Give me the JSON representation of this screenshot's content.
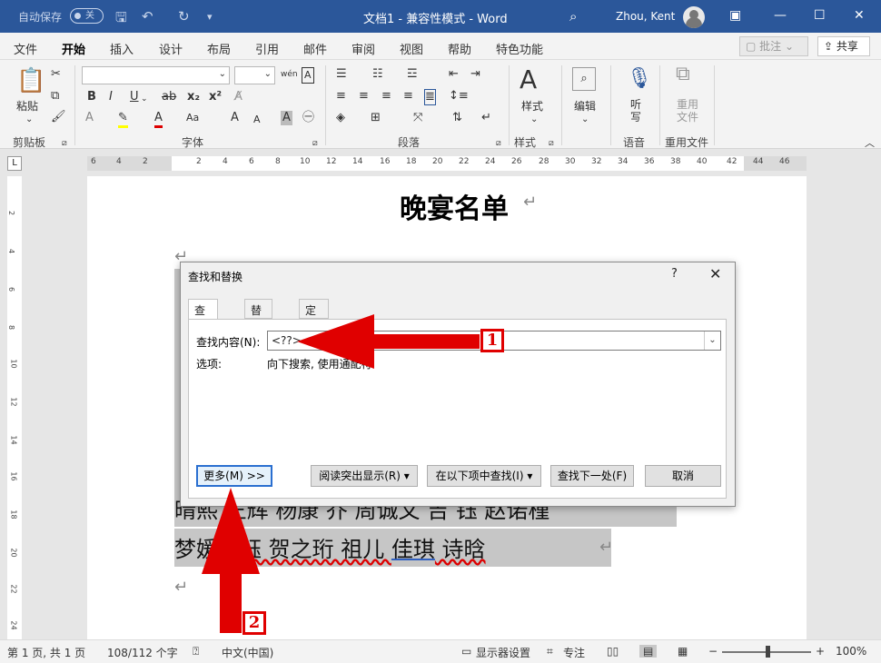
{
  "titlebar": {
    "autosave_label": "自动保存",
    "autosave_state": "关",
    "document_title": "文档1 - 兼容性模式 - Word",
    "user_name": "Zhou, Kent"
  },
  "menu": {
    "tabs": [
      "文件",
      "开始",
      "插入",
      "设计",
      "布局",
      "引用",
      "邮件",
      "审阅",
      "视图",
      "帮助",
      "特色功能"
    ],
    "comment_label": "批注",
    "share_label": "共享"
  },
  "ribbon": {
    "paste_label": "粘贴",
    "groups": [
      "剪贴板",
      "字体",
      "段落",
      "样式",
      "语音",
      "重用文件"
    ],
    "styles_label": "样式",
    "edit_label": "编辑",
    "dictate_label": "听写",
    "reuse_label": "重用文件",
    "font_buttons": [
      "B",
      "I",
      "U",
      "ab",
      "x₂",
      "x²"
    ],
    "size_buttons": [
      "A",
      "A"
    ]
  },
  "ruler": {
    "h_ticks": [
      "6",
      "4",
      "2",
      "2",
      "4",
      "6",
      "8",
      "10",
      "12",
      "14",
      "16",
      "18",
      "20",
      "22",
      "24",
      "26",
      "28",
      "30",
      "32",
      "34",
      "36",
      "38",
      "40",
      "42",
      "44",
      "46"
    ],
    "v_ticks": [
      "2",
      "4",
      "6",
      "8",
      "10",
      "12",
      "14",
      "16",
      "18",
      "20",
      "22",
      "24"
    ]
  },
  "document": {
    "title": "晚宴名单",
    "line_row1": "晴熙 王辉  杨康 乔 周诚文  吉 钰 赵诺槿",
    "line_row2_a": "梦媛",
    "line_row2_b": "涵钰  贺之珩   祖儿  ",
    "line_row2_c": "佳琪",
    "line_row2_d": "  诗晗"
  },
  "dialog": {
    "title": "查找和替换",
    "help": "?",
    "close": "✕",
    "tabs": [
      "查找(D)",
      "替换(P)",
      "定位(G)"
    ],
    "find_label": "查找内容(N):",
    "find_value": "<??>",
    "options_label": "选项:",
    "options_value": "向下搜索, 使用通配符",
    "buttons": {
      "more": "更多(M) >>",
      "reading_highlight": "阅读突出显示(R) ▾",
      "find_in": "在以下项中查找(I) ▾",
      "find_next": "查找下一处(F)",
      "cancel": "取消"
    }
  },
  "statusbar": {
    "page": "第 1 页, 共 1 页",
    "words": "108/112 个字",
    "language": "中文(中国)",
    "display": "显示器设置",
    "focus": "专注",
    "zoom": "100%"
  },
  "annotations": {
    "badge1": "1",
    "badge2": "2",
    "arrow_color": "#e00000"
  }
}
